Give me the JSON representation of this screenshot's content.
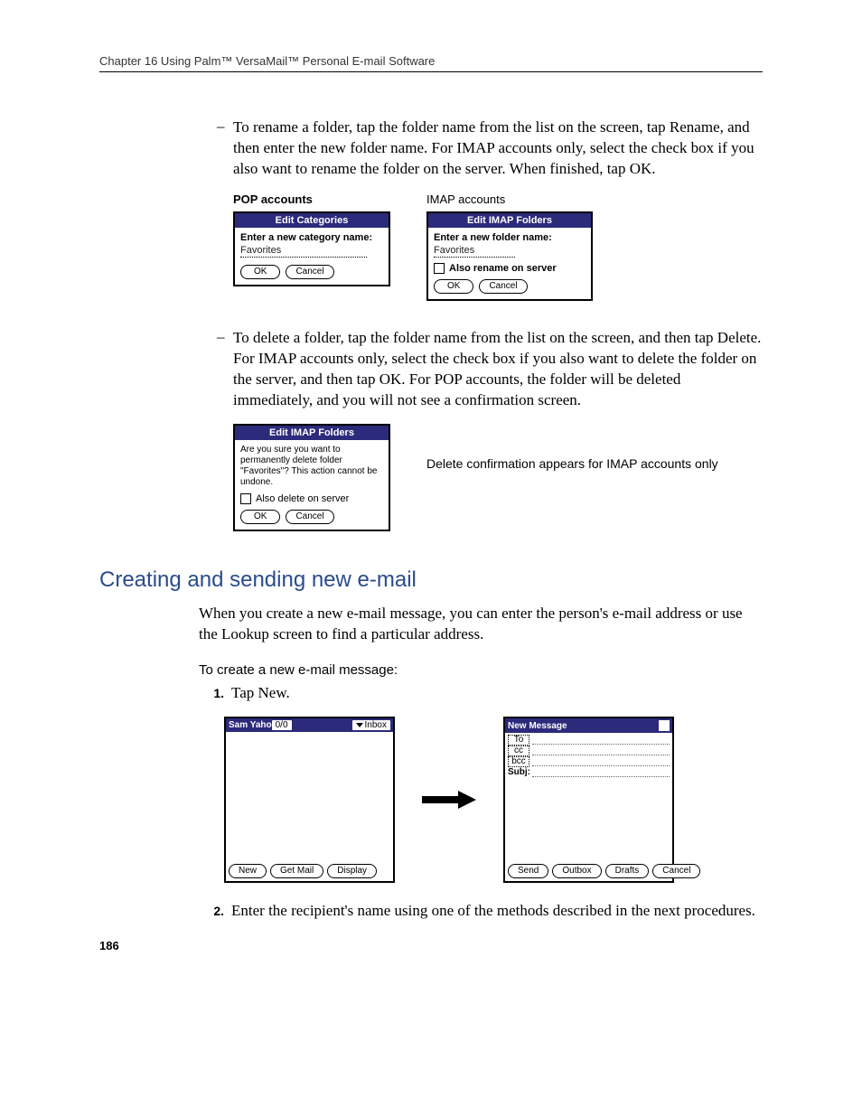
{
  "header": "Chapter 16   Using Palm™ VersaMail™ Personal E-mail Software",
  "para_rename": "To rename a folder, tap the folder name from the list on the screen, tap Rename, and then enter the new folder name. For IMAP accounts only, select the check box if you also want to rename the folder on the server. When finished, tap OK.",
  "captions": {
    "pop": "POP accounts",
    "imap": "IMAP accounts"
  },
  "popDialog": {
    "title": "Edit Categories",
    "label": "Enter a new category name:",
    "value": "Favorites",
    "ok": "OK",
    "cancel": "Cancel"
  },
  "imapDialog": {
    "title": "Edit IMAP Folders",
    "label": "Enter a new folder name:",
    "value": "Favorites",
    "check": "Also rename on server",
    "ok": "OK",
    "cancel": "Cancel"
  },
  "para_delete": "To delete a folder, tap the folder name from the list on the screen, and then tap Delete. For IMAP accounts only, select the check box if you also want to delete the folder on the server, and then tap OK. For POP accounts, the folder will be deleted immediately, and you will not see a confirmation screen.",
  "deleteDialog": {
    "title": "Edit IMAP Folders",
    "msg": "Are you sure you want to permanently delete folder \"Favorites\"? This action cannot be undone.",
    "check": "Also delete on server",
    "ok": "OK",
    "cancel": "Cancel"
  },
  "deleteNote": "Delete confirmation appears for IMAP accounts only",
  "sectionTitle": "Creating and sending new e-mail",
  "sectionPara": "When you create a new e-mail message, you can enter the person's e-mail address or use the Lookup screen to find a particular address.",
  "subHeading": "To create a new e-mail message:",
  "steps": {
    "s1num": "1.",
    "s1": "Tap New.",
    "s2num": "2.",
    "s2": "Enter the recipient's name using one of the methods described in the next procedures."
  },
  "inboxScreen": {
    "account": "Sam Yaho",
    "count": "0/0",
    "folder": "Inbox",
    "btnNew": "New",
    "btnGet": "Get Mail",
    "btnDisplay": "Display"
  },
  "newMsgScreen": {
    "title": "New Message",
    "to": "To",
    "cc": "cc",
    "bcc": "bcc",
    "subj": "Subj:",
    "btnSend": "Send",
    "btnOutbox": "Outbox",
    "btnDrafts": "Drafts",
    "btnCancel": "Cancel"
  },
  "pageNumber": "186"
}
